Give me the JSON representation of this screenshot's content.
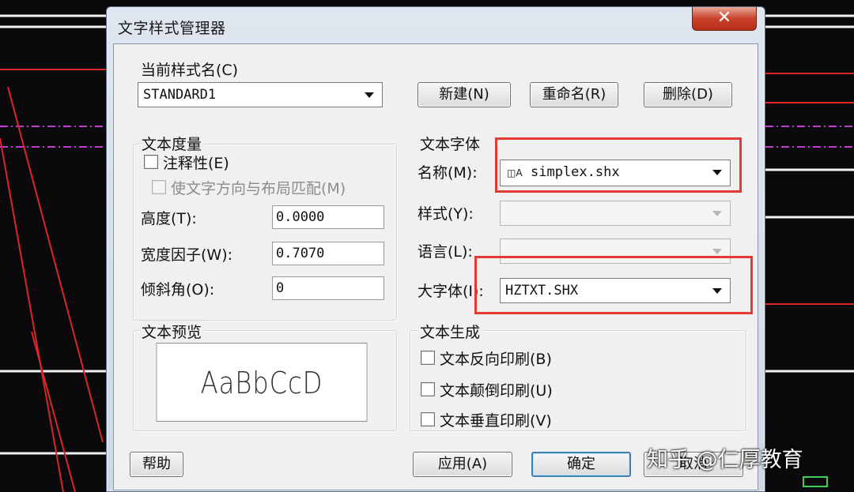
{
  "window": {
    "title": "文字样式管理器",
    "close_glyph": "✕"
  },
  "style_name": {
    "label": "当前样式名(C)",
    "value": "STANDARD1"
  },
  "buttons": {
    "new": "新建(N)",
    "rename": "重命名(R)",
    "delete": "删除(D)",
    "help": "帮助",
    "apply": "应用(A)",
    "ok": "确定",
    "cancel": "取消"
  },
  "text_metrics": {
    "title": "文本度量",
    "annotative": "注释性(E)",
    "match_orientation": "使文字方向与布局匹配(M)",
    "height_label": "高度(T):",
    "height_value": "0.0000",
    "width_label": "宽度因子(W):",
    "width_value": "0.7070",
    "oblique_label": "倾斜角(O):",
    "oblique_value": "0"
  },
  "text_font": {
    "title": "文本字体",
    "name_label": "名称(M):",
    "name_value": "simplex.shx",
    "style_label": "样式(Y):",
    "style_value": "",
    "language_label": "语言(L):",
    "language_value": "",
    "bigfont_label": "大字体(I):",
    "bigfont_value": "HZTXT.SHX"
  },
  "preview": {
    "title": "文本预览",
    "sample": "AaBbCcD"
  },
  "text_generation": {
    "title": "文本生成",
    "backwards": "文本反向印刷(B)",
    "upside_down": "文本颠倒印刷(U)",
    "vertical": "文本垂直印刷(V)"
  },
  "watermark": "知乎 @仁厚教育",
  "colors": {
    "highlight_red": "#e43a34",
    "cad_red": "#d9262a",
    "cad_magenta": "#c23ad0"
  }
}
